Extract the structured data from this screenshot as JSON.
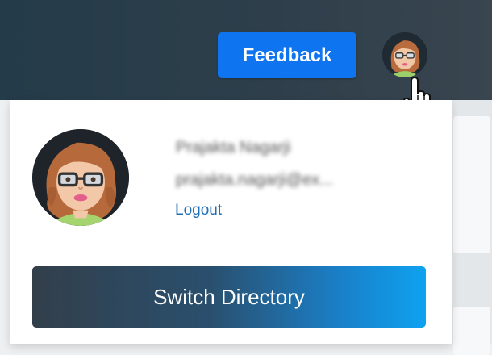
{
  "header": {
    "feedback_label": "Feedback",
    "avatar_icon": "user-avatar-icon",
    "cursor_icon": "hand-pointer-icon"
  },
  "profile_menu": {
    "user_name": "Prajakta Nagarji",
    "user_email": "prajakta.nagarji@ex...",
    "logout_label": "Logout",
    "switch_directory_label": "Switch Directory"
  },
  "colors": {
    "topbar": "#243b49",
    "feedback_button": "#0f74f0",
    "link": "#1f6fb4",
    "switch_gradient_start": "#323f4b",
    "switch_gradient_end": "#0ea2f0"
  }
}
